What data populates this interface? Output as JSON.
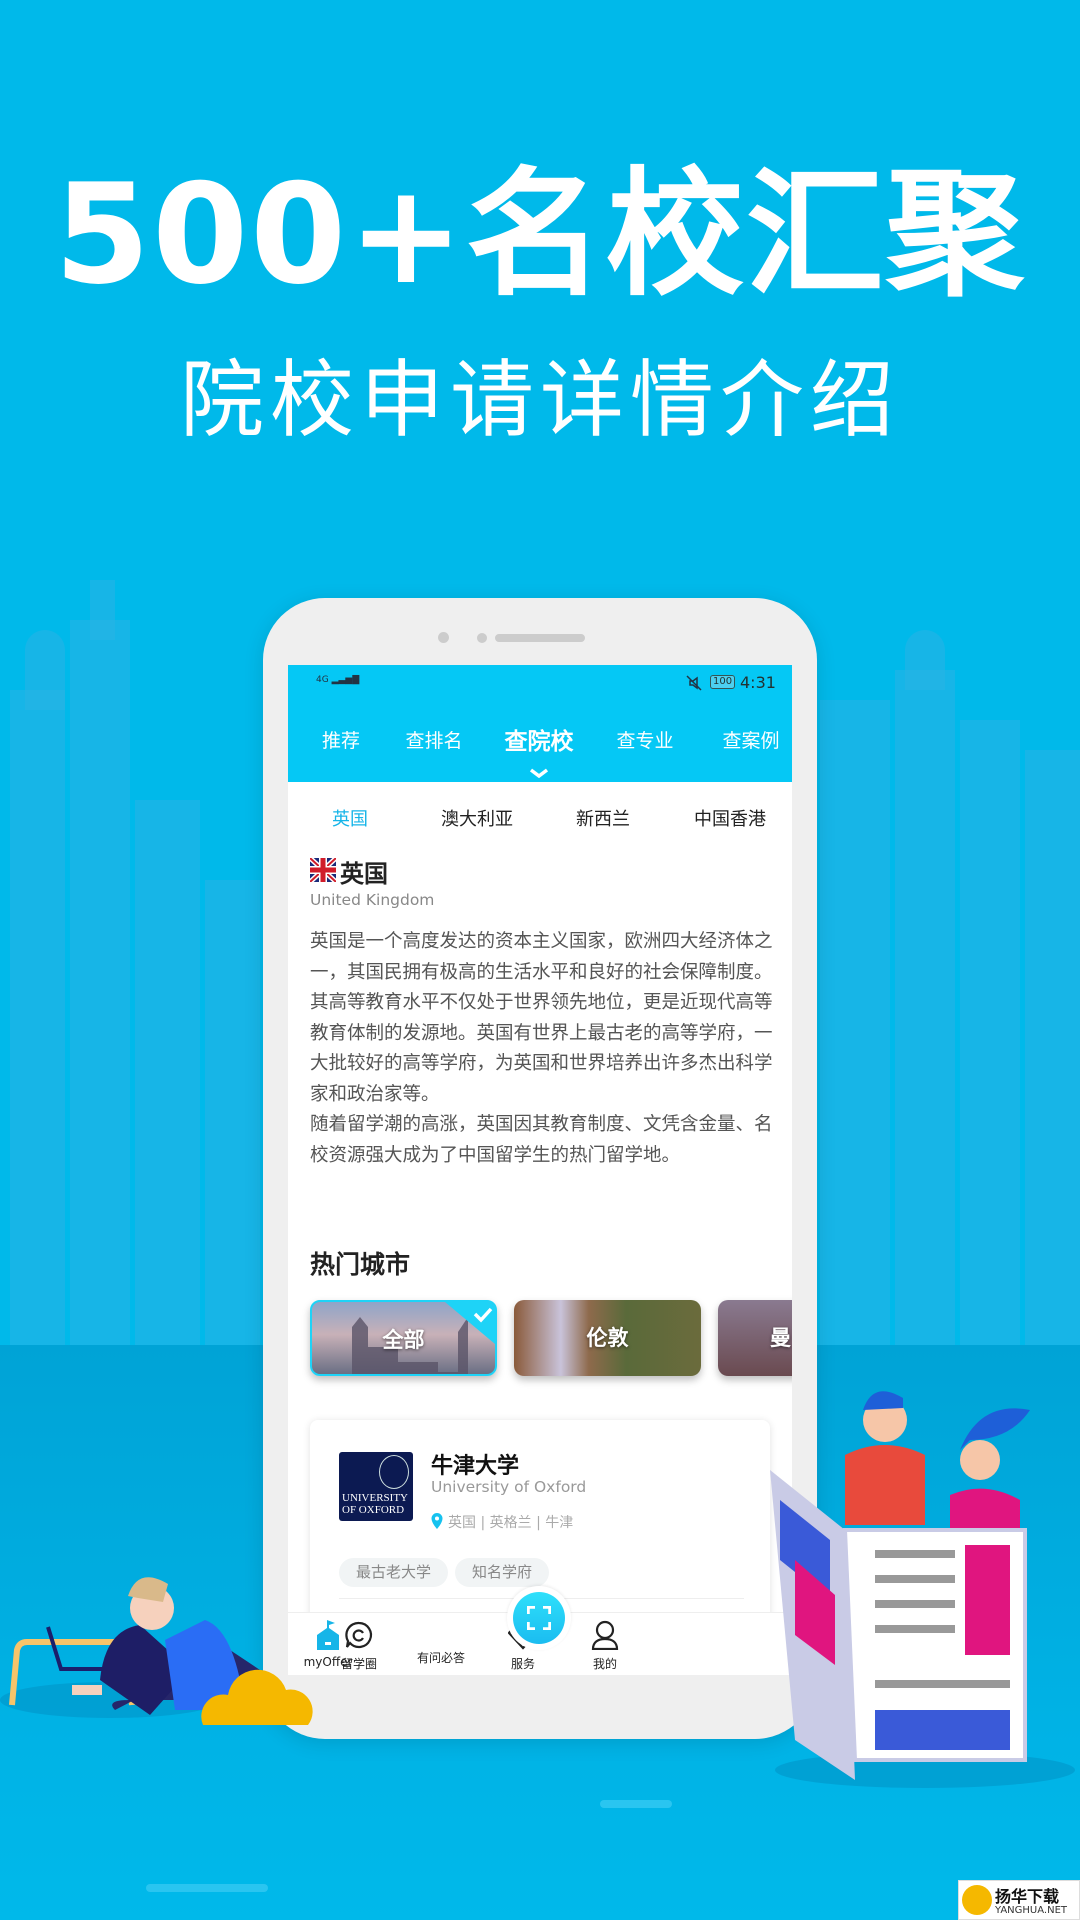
{
  "promo": {
    "headline": "500+名校汇聚",
    "subheadline": "院校申请详情介绍"
  },
  "status_bar": {
    "network": "4G",
    "battery": "100",
    "time": "4:31"
  },
  "top_tabs": [
    {
      "label": "推荐"
    },
    {
      "label": "查排名"
    },
    {
      "label": "查院校",
      "active": true
    },
    {
      "label": "查专业"
    },
    {
      "label": "查案例"
    }
  ],
  "country_tabs": [
    {
      "label": "英国",
      "active": true
    },
    {
      "label": "澳大利亚"
    },
    {
      "label": "新西兰"
    },
    {
      "label": "中国香港"
    }
  ],
  "country": {
    "name": "英国",
    "english": "United Kingdom",
    "description": "英国是一个高度发达的资本主义国家，欧洲四大经济体之一，其国民拥有极高的生活水平和良好的社会保障制度。\n 其高等教育水平不仅处于世界领先地位，更是近现代高等教育体制的发源地。英国有世界上最古老的高等学府，一大批较好的高等学府，为英国和世界培养出许多杰出科学家和政治家等。\n 随着留学潮的高涨，英国因其教育制度、文凭含金量、名校资源强大成为了中国留学生的热门留学地。"
  },
  "hot_cities": {
    "title": "热门城市",
    "items": [
      {
        "label": "全部",
        "selected": true
      },
      {
        "label": "伦敦"
      },
      {
        "label": "曼"
      }
    ]
  },
  "university": {
    "name": "牛津大学",
    "english": "University of Oxford",
    "location": "英国 | 英格兰 | 牛津",
    "logo_text": "UNIVERSITY OF OXFORD",
    "tags": [
      "最古老大学",
      "知名学府"
    ]
  },
  "bottom_nav": [
    {
      "label": "myOffer",
      "icon": "home-castle-icon",
      "active": true
    },
    {
      "label": "留学圈",
      "icon": "chat-circle-icon"
    },
    {
      "label": "有问必答",
      "icon": "scan-icon"
    },
    {
      "label": "服务",
      "icon": "diamond-icon"
    },
    {
      "label": "我的",
      "icon": "user-icon"
    }
  ],
  "watermark": {
    "cn": "扬华下载",
    "en": "YANGHUA.NET"
  },
  "colors": {
    "background": "#00b9ea",
    "accent": "#05c8f5",
    "active_tab": "#16b5e8",
    "card_selected": "#1ed3f7"
  }
}
